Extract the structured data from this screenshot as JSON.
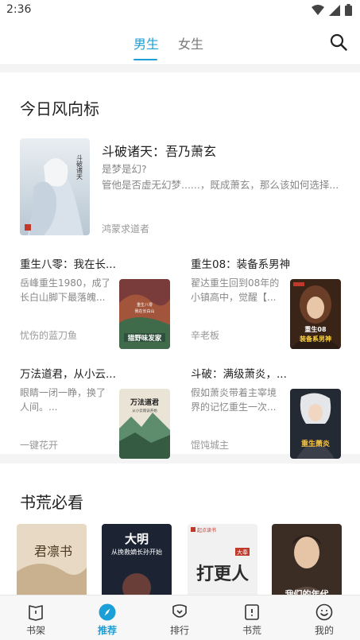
{
  "status_bar": {
    "time": "2:36"
  },
  "header": {
    "tabs": [
      {
        "label": "男生",
        "active": true
      },
      {
        "label": "女生",
        "active": false
      }
    ]
  },
  "trend": {
    "title": "今日风向标",
    "featured": {
      "title": "斗破诸天：吾乃萧玄",
      "desc_lines": [
        "是梦是幻?",
        "管他是否虚无幻梦......，既成萧玄，那么该如何选择..."
      ],
      "author": "鸿蒙求道者"
    },
    "books": [
      {
        "title": "重生八零：我在长...",
        "desc_lines": [
          "岳峰重生1980，成了",
          "长白山脚下最落魄..."
        ],
        "author": "忧伤的蓝刀鱼"
      },
      {
        "title": "重生08：装备系男神",
        "desc_lines": [
          "翟达重生回到08年的",
          "小镇高中，觉醒【..."
        ],
        "author": "辛老板"
      },
      {
        "title": "万法道君，从小云...",
        "desc_lines": [
          "眼睛一闭一睁，换了",
          "人间。..."
        ],
        "author": "一键花开"
      },
      {
        "title": "斗破：满级萧炎，...",
        "desc_lines": [
          "假如萧炎带着主宰境",
          "界的记忆重生一次..."
        ],
        "author": "馄饨城主"
      }
    ]
  },
  "must_read": {
    "title": "书荒必看"
  },
  "covers": {
    "book2": {
      "top": "重生八零",
      "mid": "我在长白山",
      "big": "猎野味发家"
    },
    "book3": {
      "big": "重生08",
      "big2": "装备系男神"
    },
    "book4": {
      "big": "万法道君",
      "sub": "从小云雨诀开始"
    },
    "book5": {
      "big": "重生萧炎"
    },
    "shelf1": {
      "big": "君凛书"
    },
    "shelf2": {
      "big": "大明",
      "sub": "从挽救嫡长孙开始"
    },
    "shelf3": {
      "badge": "起点读书",
      "big": "打更人",
      "small": "大奉"
    },
    "shelf4": {
      "big": "我们的年代"
    }
  },
  "bottom_nav": [
    {
      "label": "书架",
      "active": false
    },
    {
      "label": "推荐",
      "active": true
    },
    {
      "label": "排行",
      "active": false
    },
    {
      "label": "书荒",
      "active": false
    },
    {
      "label": "我的",
      "active": false
    }
  ],
  "colors": {
    "accent": "#1a9fd7",
    "text": "#222222",
    "muted": "#888888"
  }
}
